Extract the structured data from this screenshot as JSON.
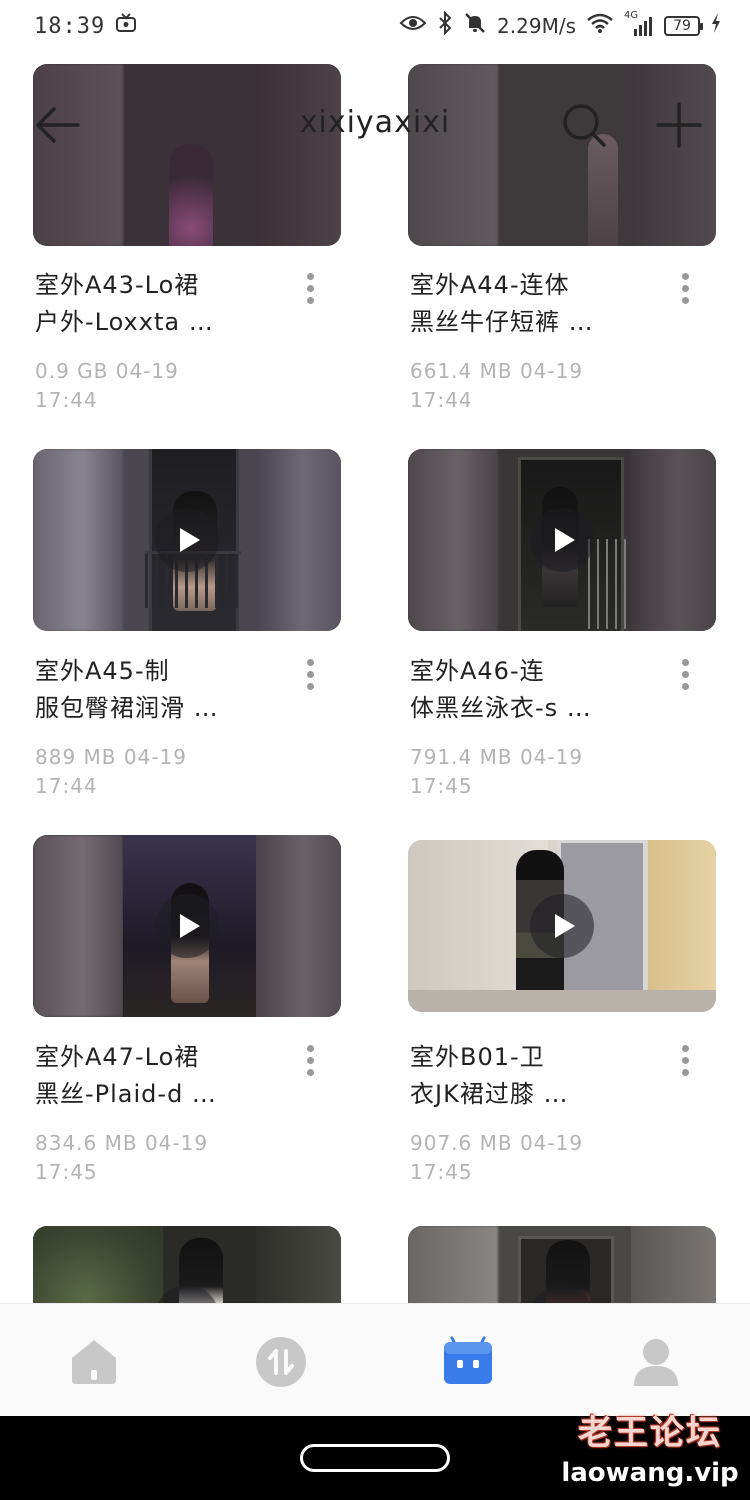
{
  "status_bar": {
    "time": "18:39",
    "network_speed": "2.29M/s",
    "network_type": "4G",
    "battery": "79"
  },
  "header": {
    "title": "xixiyaxixi",
    "icons": [
      "back-arrow-icon",
      "search-icon",
      "add-icon"
    ]
  },
  "files": [
    {
      "title": "室外A43-Lo裙\n户外-Loxxta …",
      "meta": "0.9 GB  04-19\n17:44",
      "thumb_palette": "dark-night"
    },
    {
      "title": "室外A44-连体\n黑丝牛仔短裤 …",
      "meta": "661.4 MB  04-19\n17:44",
      "thumb_palette": "dark-night"
    },
    {
      "title": "室外A45-制\n服包臀裙润滑 …",
      "meta": "889 MB  04-19\n17:44",
      "thumb_palette": "balcony-night"
    },
    {
      "title": "室外A46-连\n体黑丝泳衣-s …",
      "meta": "791.4 MB  04-19\n17:45",
      "thumb_palette": "doorway-night"
    },
    {
      "title": "室外A47-Lo裙\n黑丝-Plaid-d …",
      "meta": "834.6 MB  04-19\n17:45",
      "thumb_palette": "alley-night"
    },
    {
      "title": "室外B01-卫\n衣JK裙过膝 …",
      "meta": "907.6 MB  04-19\n17:45",
      "thumb_palette": "hallway-day"
    },
    {
      "title": "",
      "meta": "",
      "thumb_palette": "garden-night"
    },
    {
      "title": "",
      "meta": "",
      "thumb_palette": "corridor-night"
    }
  ],
  "bottom_nav": {
    "items": [
      {
        "icon": "home-icon",
        "active": false
      },
      {
        "icon": "transfer-icon",
        "active": false
      },
      {
        "icon": "files-icon",
        "active": true
      },
      {
        "icon": "profile-icon",
        "active": false
      }
    ],
    "active_color": "#3a7bea",
    "inactive_color": "#c8c8c8"
  },
  "watermark": {
    "logo_text": "老王论坛",
    "url": "laowang.vip"
  }
}
